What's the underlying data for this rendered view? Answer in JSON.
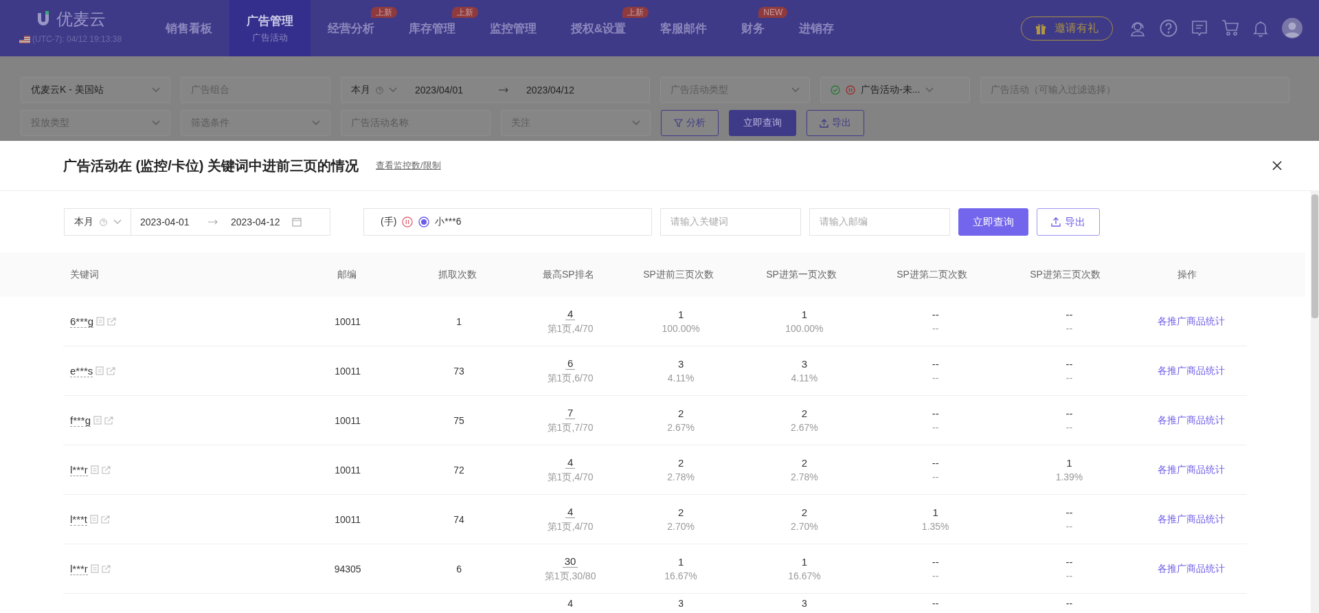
{
  "nav": {
    "logo": "优麦云",
    "timezone": "(UTC-7): 04/12 19:13:38",
    "menu": [
      {
        "label": "销售看板",
        "selected": false
      },
      {
        "label": "广告管理",
        "sub": "广告活动",
        "selected": true
      },
      {
        "label": "经营分析",
        "badge": "上新",
        "selected": false
      },
      {
        "label": "库存管理",
        "badge": "上新",
        "selected": false
      },
      {
        "label": "监控管理",
        "selected": false
      },
      {
        "label": "授权&设置",
        "badge": "上新",
        "selected": false
      },
      {
        "label": "客服邮件",
        "selected": false
      },
      {
        "label": "财务",
        "badge": "NEW",
        "selected": false
      },
      {
        "label": "进销存",
        "selected": false
      }
    ],
    "invite": "邀请有礼"
  },
  "filters": {
    "row_1": [
      {
        "kind": "select",
        "value": "优麦云K - 美国站"
      },
      {
        "kind": "placeholder",
        "placeholder": "广告组合"
      },
      {
        "kind": "daterange",
        "preset": "本月",
        "start": "2023/04/01",
        "end": "2023/04/12"
      },
      {
        "kind": "select-placeholder",
        "placeholder": "广告活动类型"
      },
      {
        "kind": "status",
        "value": "广告活动-未..."
      },
      {
        "kind": "placeholder",
        "placeholder": "广告活动（可输入过滤选择）"
      }
    ],
    "row_2": [
      {
        "kind": "select-placeholder",
        "placeholder": "投放类型"
      },
      {
        "kind": "select-placeholder",
        "placeholder": "筛选条件"
      },
      {
        "kind": "placeholder",
        "placeholder": "广告活动名称"
      },
      {
        "kind": "select-placeholder",
        "placeholder": "关注"
      }
    ],
    "buttons": [
      {
        "kind": "filter",
        "label": "分析"
      },
      {
        "kind": "primary",
        "label": "立即查询"
      },
      {
        "kind": "export",
        "label": "导出"
      }
    ]
  },
  "modal": {
    "title": "广告活动在 (监控/卡位) 关键词中进前三页的情况",
    "link": "查看监控数/限制",
    "preset": "本月",
    "start": "2023-04-01",
    "end": "2023-04-12",
    "campaign_prefix": "(手)",
    "campaign": "小***6",
    "keyword_placeholder": "请输入关键词",
    "zip_placeholder": "请输入邮编",
    "search_button": "立即查询",
    "export_button": "导出"
  },
  "table": {
    "columns": [
      "关键词",
      "邮编",
      "抓取次数",
      "最高SP排名",
      "SP进前三页次数",
      "SP进第一页次数",
      "SP进第二页次数",
      "SP进第三页次数",
      "操作"
    ],
    "rows": [
      {
        "keyword": "6***g",
        "zip": "10011",
        "fetches": "1",
        "rank": "4",
        "rank_detail": "第1页,4/70",
        "top3": [
          "1",
          "100.00%"
        ],
        "page1": [
          "1",
          "100.00%"
        ],
        "page2": [
          "--",
          "--"
        ],
        "page3": [
          "--",
          "--"
        ],
        "action": "各推广商品统计"
      },
      {
        "keyword": "e***s",
        "zip": "10011",
        "fetches": "73",
        "rank": "6",
        "rank_detail": "第1页,6/70",
        "top3": [
          "3",
          "4.11%"
        ],
        "page1": [
          "3",
          "4.11%"
        ],
        "page2": [
          "--",
          "--"
        ],
        "page3": [
          "--",
          "--"
        ],
        "action": "各推广商品统计"
      },
      {
        "keyword": "f***g",
        "zip": "10011",
        "fetches": "75",
        "rank": "7",
        "rank_detail": "第1页,7/70",
        "top3": [
          "2",
          "2.67%"
        ],
        "page1": [
          "2",
          "2.67%"
        ],
        "page2": [
          "--",
          "--"
        ],
        "page3": [
          "--",
          "--"
        ],
        "action": "各推广商品统计"
      },
      {
        "keyword": "l***r",
        "zip": "10011",
        "fetches": "72",
        "rank": "4",
        "rank_detail": "第1页,4/70",
        "top3": [
          "2",
          "2.78%"
        ],
        "page1": [
          "2",
          "2.78%"
        ],
        "page2": [
          "--",
          "--"
        ],
        "page3": [
          "1",
          "1.39%"
        ],
        "action": "各推广商品统计"
      },
      {
        "keyword": "l***t",
        "zip": "10011",
        "fetches": "74",
        "rank": "4",
        "rank_detail": "第1页,4/70",
        "top3": [
          "2",
          "2.70%"
        ],
        "page1": [
          "2",
          "2.70%"
        ],
        "page2": [
          "1",
          "1.35%"
        ],
        "page3": [
          "--",
          "--"
        ],
        "action": "各推广商品统计"
      },
      {
        "keyword": "l***r",
        "zip": "94305",
        "fetches": "6",
        "rank": "30",
        "rank_detail": "第1页,30/80",
        "top3": [
          "1",
          "16.67%"
        ],
        "page1": [
          "1",
          "16.67%"
        ],
        "page2": [
          "--",
          "--"
        ],
        "page3": [
          "--",
          "--"
        ],
        "action": "各推广商品统计"
      }
    ],
    "partial_row": {
      "rank": "4",
      "top3": "3",
      "page1": "3",
      "page2": "--",
      "page3": "--"
    }
  }
}
